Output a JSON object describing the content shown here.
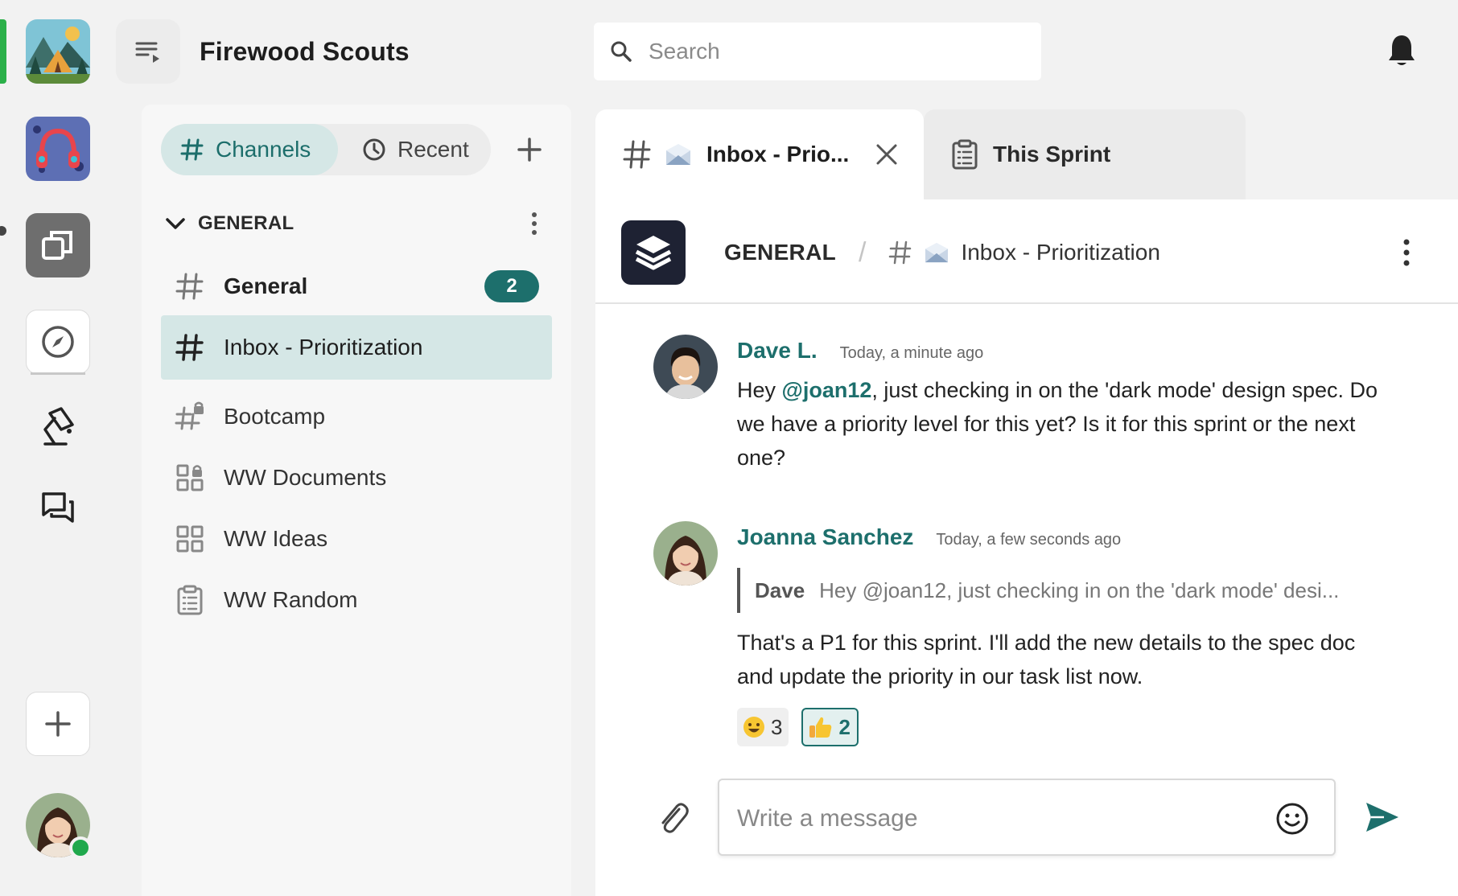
{
  "org": {
    "title": "Firewood Scouts"
  },
  "search": {
    "placeholder": "Search"
  },
  "channels_panel": {
    "tabs": [
      {
        "label": "Channels",
        "active": true
      },
      {
        "label": "Recent",
        "active": false
      }
    ],
    "section": {
      "label": "GENERAL"
    },
    "items": [
      {
        "label": "General",
        "icon": "hash-icon",
        "badge": "2",
        "bold": true
      },
      {
        "label": "Inbox - Prioritization",
        "icon": "hash-icon",
        "active": true
      },
      {
        "label": "Bootcamp",
        "icon": "hash-lock-icon"
      },
      {
        "label": "WW Documents",
        "icon": "grid-lock-icon"
      },
      {
        "label": "WW Ideas",
        "icon": "grid-icon"
      },
      {
        "label": "WW Random",
        "icon": "clipboard-icon"
      }
    ]
  },
  "main_tabs": [
    {
      "label": "Inbox - Prio...",
      "active": true
    },
    {
      "label": "This Sprint",
      "active": false
    }
  ],
  "channel_header": {
    "section": "GENERAL",
    "channel": "Inbox - Prioritization"
  },
  "messages": [
    {
      "author": "Dave L.",
      "time": "Today, a minute ago",
      "text_before": "Hey ",
      "mention": "@joan12",
      "text_after": ", just checking in on the 'dark mode' design spec. Do we have a priority level for this yet? Is it for this sprint or the next one?"
    },
    {
      "author": "Joanna Sanchez",
      "time": "Today, a few seconds ago",
      "quote_author": "Dave",
      "quote_text": "Hey @joan12, just checking in on the 'dark mode' desi...",
      "text": "That's a P1 for this sprint. I'll add the new details to the spec doc and update the priority in our task list now.",
      "reactions": [
        {
          "emoji": "grinning-face",
          "count": "3",
          "mine": false
        },
        {
          "emoji": "thumbs-up",
          "count": "2",
          "mine": true
        }
      ]
    }
  ],
  "composer": {
    "placeholder": "Write a message"
  },
  "colors": {
    "accent": "#1d6f6c",
    "accent_light": "#d5e7e6",
    "online": "#1fa84c",
    "active_rail": "#2bb049"
  }
}
